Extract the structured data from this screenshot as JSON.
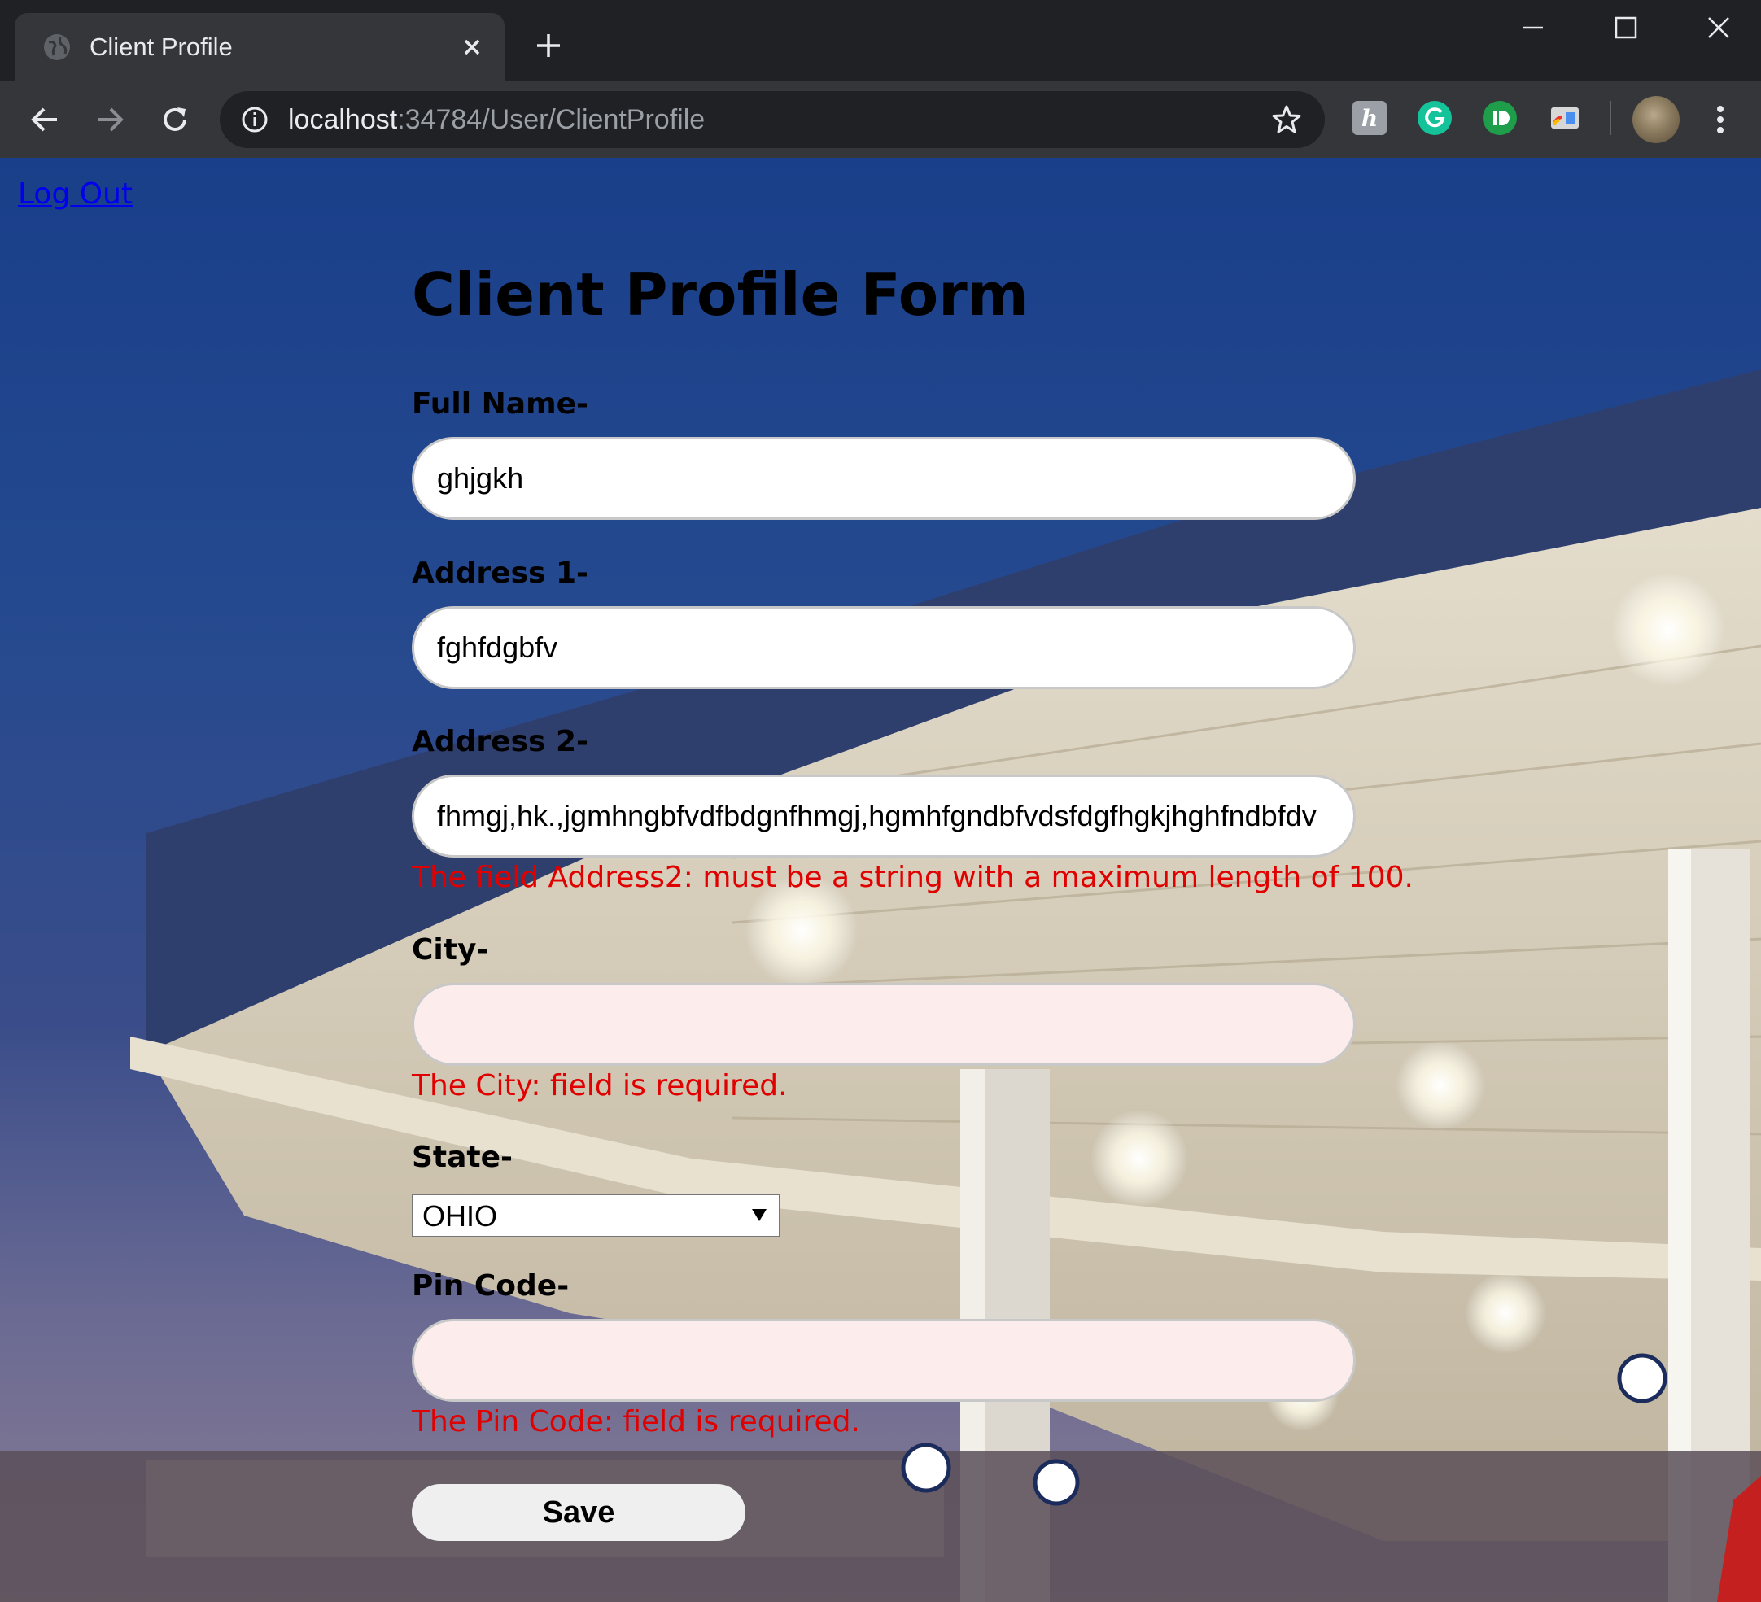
{
  "browser": {
    "tab_title": "Client Profile",
    "url_host": "localhost",
    "url_rest": ":34784/User/ClientProfile",
    "icons": {
      "favicon": "globe-icon",
      "close": "close-icon",
      "new_tab": "plus-icon",
      "back": "back-arrow-icon",
      "forward": "forward-arrow-icon",
      "reload": "reload-icon",
      "info": "info-icon",
      "bookmark": "star-icon",
      "menu": "kebab-menu-icon"
    },
    "extensions": [
      "honey-extension-icon",
      "grammarly-extension-icon",
      "id-extension-icon",
      "cast-extension-icon"
    ]
  },
  "page": {
    "logout_link": "Log Out",
    "title": "Client Profile Form",
    "fields": {
      "full_name": {
        "label": "Full Name-",
        "value": "ghjgkh"
      },
      "address1": {
        "label": "Address 1-",
        "value": "fghfdgbfv"
      },
      "address2": {
        "label": "Address 2-",
        "value": "fhmgj,hk.,jgmhngbfvdfbdgnfhmgj,hgmhfgndbfvdsfdgfhgkjhghfndbfdv",
        "error": "The field Address2: must be a string with a maximum length of 100."
      },
      "city": {
        "label": "City-",
        "value": "",
        "error": "The City: field is required."
      },
      "state": {
        "label": "State-",
        "selected": "OHIO"
      },
      "pin_code": {
        "label": "Pin Code-",
        "value": "",
        "error": "The Pin Code: field is required."
      }
    },
    "save_label": "Save"
  },
  "colors": {
    "error": "#e00000",
    "link": "#0000ee",
    "invalid_field_bg": "#fdecec"
  }
}
